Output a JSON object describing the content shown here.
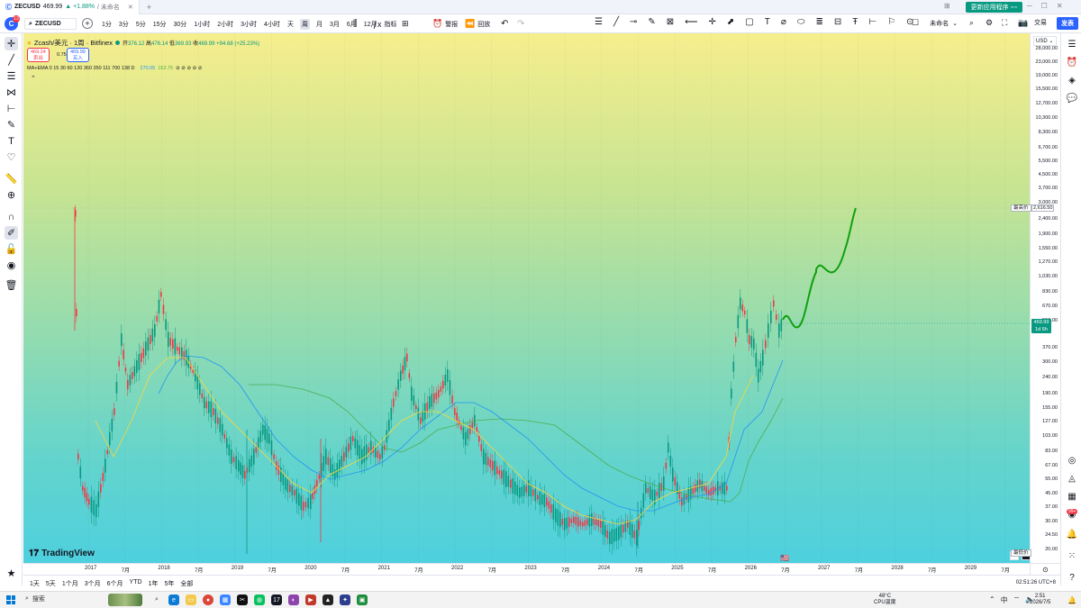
{
  "browser_tab": {
    "symbol": "ZECUSD",
    "price": "469.99",
    "change": "▲ +1.88%",
    "rest": "/ 未命名",
    "close": "✕",
    "new_tab": "+"
  },
  "titlebar": {
    "update_label": "更新应用程序 ◦◦◦"
  },
  "toolbar": {
    "logo_letter": "C",
    "logo_badge": "13",
    "symbol": "ZECUSD",
    "intervals": [
      "1分",
      "3分",
      "5分",
      "15分",
      "30分",
      "1小时",
      "2小时",
      "3小时",
      "4小时",
      "天",
      "周",
      "月",
      "3月",
      "6月",
      "12月"
    ],
    "active_interval": "周",
    "indicators_label": "指标",
    "alert_label": "警报",
    "replay_label": "回放",
    "layout_name": "未命名",
    "trade_label": "交易",
    "publish_label": "发表"
  },
  "legend": {
    "title": "Zcash/美元 · 1周 · Bitfinex",
    "open_label": "开",
    "open": "376.12",
    "high_label": "高",
    "high": "476.14",
    "low_label": "低",
    "low": "369.93",
    "close_label": "收",
    "close": "469.99",
    "change": "+94.68 (+25.23%)",
    "sell_price": "469.24",
    "sell_label": "卖出",
    "spread": "0.75",
    "buy_price": "469.99",
    "buy_label": "买入",
    "ma_title": "MA+EMA 0 15 30 60 120 360 350 111 700 138 D",
    "ma_v1": "",
    "ma_v2": "270.05",
    "ma_v3": "152.75",
    "ma_icons": "⊘ ⊘ ⊘ ⊘ ⊘",
    "collapse": "⌃"
  },
  "price_axis": {
    "currency": "USD",
    "labels": [
      "28,000.00",
      "23,000.00",
      "19,000.00",
      "15,500.00",
      "12,700.00",
      "10,300.00",
      "8,300.00",
      "6,700.00",
      "5,500.00",
      "4,500.00",
      "3,700.00",
      "3,000.00",
      "2,400.00",
      "1,900.00",
      "1,550.00",
      "1,270.00",
      "1,030.00",
      "830.00",
      "670.00",
      "550.00",
      "370.00",
      "300.00",
      "240.00",
      "190.00",
      "155.00",
      "127.00",
      "103.00",
      "83.00",
      "67.00",
      "55.00",
      "45.00",
      "37.00",
      "30.00",
      "24.50",
      "20.00"
    ],
    "current_price": "469.99",
    "current_countdown": "1d 6h",
    "high_label": "最高价",
    "high_value": "2,616.50",
    "low_label": "最低价"
  },
  "time_axis": {
    "labels": [
      "2017",
      "7月",
      "2018",
      "7月",
      "2019",
      "7月",
      "2020",
      "7月",
      "2021",
      "7月",
      "2022",
      "7月",
      "2023",
      "7月",
      "2024",
      "7月",
      "2025",
      "7月",
      "2026",
      "7月",
      "2027",
      "7月",
      "2028",
      "7月",
      "2029",
      "7月"
    ]
  },
  "bottom_bar": {
    "ranges": [
      "1天",
      "5天",
      "1个月",
      "3个月",
      "6个月",
      "YTD",
      "1年",
      "5年",
      "全部"
    ],
    "clock": "02:51:26 UTC+8"
  },
  "chart_misc": {
    "brand": "TradingView",
    "btn_a": "A",
    "btn_l": "L",
    "flag": "🇺🇸"
  },
  "taskbar": {
    "search": "搜索",
    "weather_temp": "48°C",
    "weather_desc": "CPU温度",
    "time": "2:51",
    "date": "2026/7/5",
    "lang": "中"
  },
  "colors": {
    "accent": "#2962ff",
    "up": "#089981",
    "down": "#f23645",
    "ma_fast": "#fdd835",
    "ma_mid": "#2196f3",
    "ma_slow": "#4caf50",
    "projection": "#10a010"
  },
  "icons": {
    "left": [
      "crosshair-icon",
      "trendline-icon",
      "fib-icon",
      "pattern-icon",
      "measure-icon",
      "brush-icon",
      "text-icon",
      "heart-icon",
      "ruler-icon",
      "zoom-icon",
      "magnet-icon",
      "lock-draw-icon",
      "lock-icon",
      "eye-icon",
      "trash-icon"
    ],
    "right": [
      "watchlist-icon",
      "alert-clock-icon",
      "layers-icon",
      "chat-icon",
      "target-icon",
      "ideas-icon",
      "calendar-icon",
      "stream-icon",
      "bell-icon",
      "apps-icon",
      "help-icon"
    ]
  }
}
